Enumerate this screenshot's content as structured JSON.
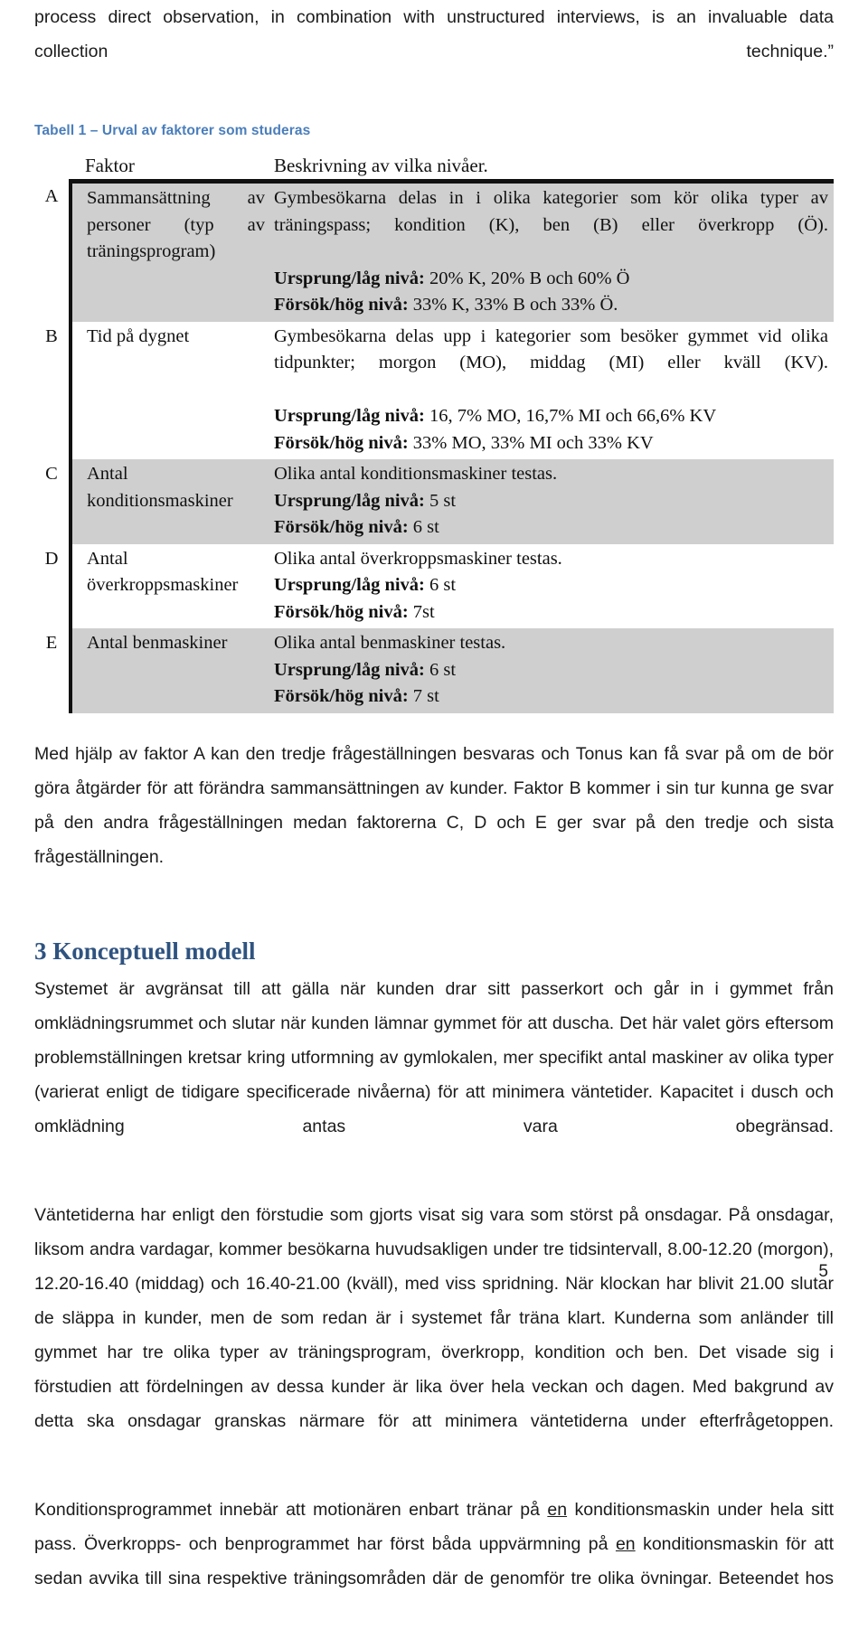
{
  "intro": {
    "paragraph": "process direct observation, in combination with unstructured interviews, is an invaluable data collection technique.”"
  },
  "table": {
    "caption": "Tabell 1 – Urval av faktorer som studeras",
    "headers": {
      "letter": "",
      "faktor": "Faktor",
      "beskrivning": "Beskrivning av vilka nivåer."
    },
    "rows": [
      {
        "letter": "A",
        "faktor": "Sammansättning av personer (typ av träningsprogram)",
        "desc_intro": "Gymbesökarna delas in i olika kategorier som kör olika typer av träningspass; kondition (K), ben (B) eller överkropp (Ö).",
        "low_label": "Ursprung/låg nivå:",
        "low_value": "20% K, 20% B och 60% Ö",
        "high_label": "Försök/hög nivå:",
        "high_value": "33% K, 33% B och 33% Ö."
      },
      {
        "letter": "B",
        "faktor": "Tid på dygnet",
        "desc_intro": "Gymbesökarna delas upp i kategorier som besöker gymmet vid olika tidpunkter; morgon (MO), middag (MI) eller kväll (KV).",
        "low_label": "Ursprung/låg nivå:",
        "low_value": "16, 7% MO, 16,7% MI och 66,6% KV",
        "high_label": "Försök/hög nivå:",
        "high_value": "33% MO, 33% MI och 33% KV"
      },
      {
        "letter": "C",
        "faktor": "Antal konditionsmaskiner",
        "desc_intro": "Olika antal konditionsmaskiner testas.",
        "low_label": "Ursprung/låg nivå:",
        "low_value": "5 st",
        "high_label": "Försök/hög nivå:",
        "high_value": "6 st"
      },
      {
        "letter": "D",
        "faktor": "Antal överkroppsmaskiner",
        "desc_intro": "Olika antal överkroppsmaskiner testas.",
        "low_label": "Ursprung/låg nivå:",
        "low_value": "6 st",
        "high_label": "Försök/hög nivå:",
        "high_value": "7st"
      },
      {
        "letter": "E",
        "faktor": "Antal benmaskiner",
        "desc_intro": "Olika antal benmaskiner testas.",
        "low_label": "Ursprung/låg nivå:",
        "low_value": "6 st",
        "high_label": "Försök/hög nivå:",
        "high_value": "7 st"
      }
    ]
  },
  "after_table": {
    "paragraph": "Med hjälp av faktor A kan den tredje frågeställningen besvaras och Tonus kan få svar på om de bör göra åtgärder för att förändra sammansättningen av kunder. Faktor B kommer i sin tur kunna ge svar på den andra frågeställningen medan faktorerna C, D och E ger svar på den tredje och sista frågeställningen."
  },
  "section": {
    "heading": "3 Konceptuell modell",
    "paragraph1": "Systemet är avgränsat till att gälla när kunden drar sitt passerkort och går in i gymmet från omklädningsrummet och slutar när kunden lämnar gymmet för att duscha. Det här valet görs eftersom problemställningen kretsar kring utformning av gymlokalen, mer specifikt antal maskiner av olika typer (varierat enligt de tidigare specificerade nivåerna) för att minimera väntetider. Kapacitet i dusch och omklädning antas vara obegränsad.",
    "paragraph2": "Väntetiderna har enligt den förstudie som gjorts visat sig vara som störst på onsdagar. På onsdagar, liksom andra vardagar, kommer besökarna huvudsakligen under tre tidsintervall, 8.00-12.20 (morgon), 12.20-16.40 (middag) och 16.40-21.00 (kväll), med viss spridning. När klockan har blivit 21.00 slutar de släppa in kunder, men de som redan är i systemet får träna klart. Kunderna som anländer till gymmet har tre olika typer av träningsprogram, överkropp, kondition och ben. Det visade sig i förstudien att fördelningen av dessa kunder är lika över hela veckan och dagen. Med bakgrund av detta ska onsdagar granskas närmare för att minimera väntetiderna under efterfrågetoppen.",
    "paragraph3_part1": "Konditionsprogrammet innebär att motionären enbart tränar på ",
    "paragraph3_em1": "en",
    "paragraph3_part2": " konditionsmaskin under hela sitt pass. Överkropps- och benprogrammet har först båda uppvärmning på ",
    "paragraph3_em2": "en",
    "paragraph3_part3": " konditionsmaskin för att sedan avvika till sina respektive träningsområden där de genomför tre olika övningar. Beteendet hos"
  },
  "footer": {
    "page_number": "5"
  },
  "colors": {
    "caption_blue": "#4a7ebb",
    "heading_navy": "#2f5380",
    "row_shade": "#cfcfcf",
    "rule_black": "#111111"
  }
}
